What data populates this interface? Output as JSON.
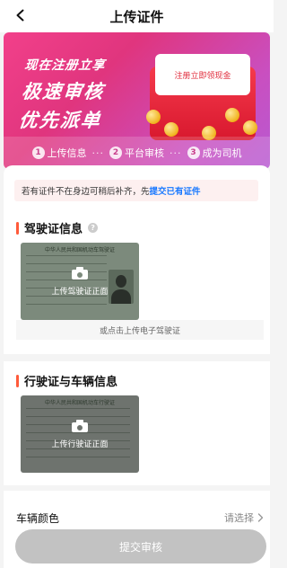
{
  "nav": {
    "title": "上传证件"
  },
  "banner": {
    "slogan_line1": "现在注册立享",
    "slogan_line2": "极速审核",
    "slogan_line3": "优先派单",
    "envelope_text": "注册立即领现金",
    "steps": [
      {
        "num": "1",
        "label": "上传信息"
      },
      {
        "num": "2",
        "label": "平台审核"
      },
      {
        "num": "3",
        "label": "成为司机"
      }
    ],
    "dots": "···",
    "colors": {
      "gradient_start": "#f2408a",
      "gradient_end": "#b75ad2",
      "envelope": "#e0202f"
    }
  },
  "notice": {
    "text": "若有证件不在身边可稍后补齐，先",
    "link": "提交已有证件"
  },
  "driver_licence": {
    "title": "驾驶证信息",
    "help_icon": "?",
    "card_header": "中华人民共和国机动车驾驶证",
    "upload_label": "上传驾驶证正面",
    "alt_label": "或点击上传电子驾驶证"
  },
  "vehicle_licence": {
    "title": "行驶证与车辆信息",
    "card_header": "中华人民共和国机动车行驶证",
    "upload_label": "上传行驶证正面"
  },
  "vehicle_color": {
    "label": "车辆颜色",
    "value": "请选择"
  },
  "submit": {
    "label": "提交审核",
    "color": "#c2c2c2"
  },
  "accent": {
    "link": "#1677ff",
    "section_bar": "#ff5a3a"
  }
}
